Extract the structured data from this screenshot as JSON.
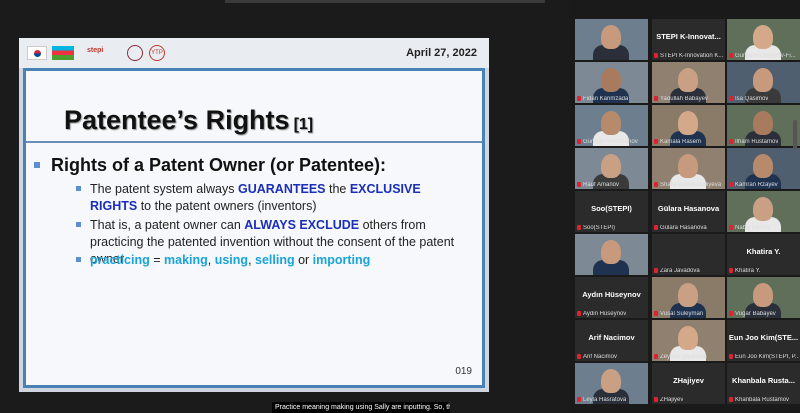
{
  "slide": {
    "date": "April 27, 2022",
    "logo_text": "stepi",
    "logo_ytp": "YTP",
    "title": "Patentee’s Rights",
    "title_ref": "[1]",
    "main_bullet": "Rights of a Patent Owner (or Patentee):",
    "sub1": {
      "t1": "The patent system always ",
      "h1": "GUARANTEES",
      "t2": " the ",
      "h2": "EXCLUSIVE RIGHTS",
      "t3": " to the patent owners (inventors)"
    },
    "sub2": {
      "t1": "That is, a patent owner can ",
      "h1": "ALWAYS EXCLUDE",
      "t2": " others from practicing the patented invention without the consent of the patent owner"
    },
    "sub3": {
      "h1": "practicing",
      "t1": " = ",
      "h2": "making",
      "t2": ", ",
      "h3": "using",
      "t3": ", ",
      "h4": "selling",
      "t4": " or ",
      "h5": "importing"
    },
    "page_number": "019"
  },
  "caption": "Practice meaning making using Sally are inputting. So, the",
  "participants": [
    {
      "label": "",
      "big": "",
      "video": true,
      "active": true
    },
    {
      "label": "STEPI K-Innovation K...",
      "big": "STEPI  K-Innovat...",
      "video": false
    },
    {
      "label": "Gunjamin Seyidov-Fi...",
      "big": "",
      "video": true
    },
    {
      "label": "Fidan Karimzada",
      "big": "",
      "video": true
    },
    {
      "label": "Yadullah Babayev",
      "big": "",
      "video": true
    },
    {
      "label": "Isa Qasimov",
      "big": "",
      "video": true
    },
    {
      "label": "Gunduz Ramazanov",
      "big": "",
      "video": true
    },
    {
      "label": "Kamala Rasem",
      "big": "",
      "video": true
    },
    {
      "label": "Ilham Rustamov",
      "big": "",
      "video": true
    },
    {
      "label": "Rauf Amanov",
      "big": "",
      "video": true
    },
    {
      "label": "Shafa Mammadaliyeva",
      "big": "",
      "video": true
    },
    {
      "label": "Kamran Rzayev",
      "big": "",
      "video": true
    },
    {
      "label": "Soo(STEPI)",
      "big": "Soo(STEPI)",
      "video": false
    },
    {
      "label": "Gülara Hasanova",
      "big": "Gülara Hasanova",
      "video": false
    },
    {
      "label": "Nabiy Pasha",
      "big": "",
      "video": true
    },
    {
      "label": "",
      "big": "",
      "video": true
    },
    {
      "label": "Zara Javadova",
      "big": "",
      "video": false
    },
    {
      "label": "Khatira Y.",
      "big": "Khatira Y.",
      "video": false
    },
    {
      "label": "Aydin Hüseynov",
      "big": "Aydın Hüseynov",
      "video": false
    },
    {
      "label": "Vusal Suleyman",
      "big": "",
      "video": true
    },
    {
      "label": "Vugar Babayev",
      "big": "",
      "video": true
    },
    {
      "label": "Arif Nacimov",
      "big": "Arif Nacimov",
      "video": false
    },
    {
      "label": "Zeyneb Qiyasova",
      "big": "",
      "video": true
    },
    {
      "label": "Eun Joo Kim(STEPI, P...",
      "big": "Eun Joo Kim(STE...",
      "video": false
    },
    {
      "label": "Leyla Hasratova",
      "big": "",
      "video": true
    },
    {
      "label": "ZHajiyev",
      "big": "ZHajiyev",
      "video": false
    },
    {
      "label": "Khanbala Rustamov",
      "big": "Khanbala  Rusta...",
      "video": false
    }
  ],
  "colors": {
    "slide_border": "#4a82b7",
    "highlight_navy": "#1a2eb8",
    "highlight_cyan": "#1aa3d9",
    "active_speaker": "#e8c84a"
  }
}
